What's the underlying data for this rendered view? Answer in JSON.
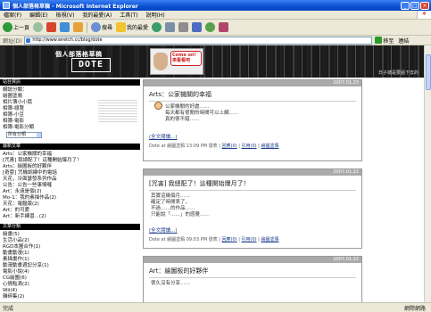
{
  "window": {
    "title": "個人部落格草稿 - Microsoft Internet Explorer",
    "buttons": [
      "_",
      "□",
      "×"
    ]
  },
  "menubar": {
    "items": [
      "檔案(F)",
      "編輯(E)",
      "檢視(V)",
      "我的最愛(A)",
      "工具(T)",
      "說明(H)"
    ]
  },
  "toolbar": {
    "back_label": "上一頁",
    "search_label": "搜尋",
    "favorites_label": "我的最愛"
  },
  "addressbar": {
    "label": "網址(D)",
    "url": "http://www.wretch.cc/blog/dote",
    "go_label": "移至",
    "links_label": "連結"
  },
  "blog": {
    "header_title": "個人部落格草稿",
    "logo_text": "DOTE",
    "bubble_text": "Come on! 來看看吧",
    "tagline": "日子總是要過下去的"
  },
  "sidebar": {
    "sections": [
      {
        "heading": "站台資訊",
        "lines": [
          "網誌分類：",
          "繪圖塗鴉",
          "相片簿小小窩",
          "相簿-總覽",
          "相簿-小豆",
          "相簿-電影",
          "相簿-電影分類"
        ]
      },
      {
        "heading": "最新文章",
        "lines": [
          "Arts：公家機關的幸福",
          "[咒害] 我總配了！這種開始爆月了！",
          "Arts：繪圖板的好夥伴",
          "[奇耍] 咒機訓練中的電話",
          "天花，冷面瑟發系列作品",
          "公告：公告一些事情囉",
          "Art：永遠是個(2)",
          "Mo-1：我的素描作品(2)",
          "天花：電腦版(2)",
          "Art：的可愛",
          "Art：新手練習...(2)"
        ]
      },
      {
        "heading": "文章分類",
        "lines": [
          "繪畫(5)",
          "生活小品(2)",
          "RGD本圖合作(1)",
          "動畫動漫(1)",
          "素描畫作(1)",
          "動漫動畫週記分享(1)",
          "電影小說(4)",
          "CG繪圖(6)",
          "心情點滴(2)",
          "Wii(4)",
          "雜碎集(2)"
        ]
      }
    ],
    "select_value": "所有分類"
  },
  "posts": [
    {
      "date": "2007.01.23",
      "title": "Arts：公家機關的幸福",
      "body_lines": [
        "公家機關的好處……",
        "每天都有很閒的時間可以上網……",
        "真的很不錯……"
      ],
      "more": "(全文閱讀...)",
      "footer_prefix": "Dote at 繪圖塗鴉 13:09 PM 發表",
      "footer_links": [
        "回應(0)",
        "引用(0)",
        "繪圖塗鴉"
      ]
    },
    {
      "date": "2007.01.22",
      "title": "[咒害] 我總配了！這種開始爆月了！",
      "body_lines": [
        "其實這幾個月……",
        "確定了時間表了，",
        "不過……的作品……",
        "只能說「……」的感覺……"
      ],
      "more": "(全文閱讀...)",
      "footer_prefix": "Dote at 繪圖塗鴉 09:03 PM 發表",
      "footer_links": [
        "回應(0)",
        "引用(0)",
        "繪圖塗鴉"
      ]
    },
    {
      "date": "2007.01.22",
      "title": "Art：繪圖板的好夥伴",
      "body_lines": [
        "很久沒有分享……"
      ],
      "more": "",
      "footer_prefix": "",
      "footer_links": []
    }
  ],
  "statusbar": {
    "text": "完成",
    "zone": "網際網路"
  }
}
